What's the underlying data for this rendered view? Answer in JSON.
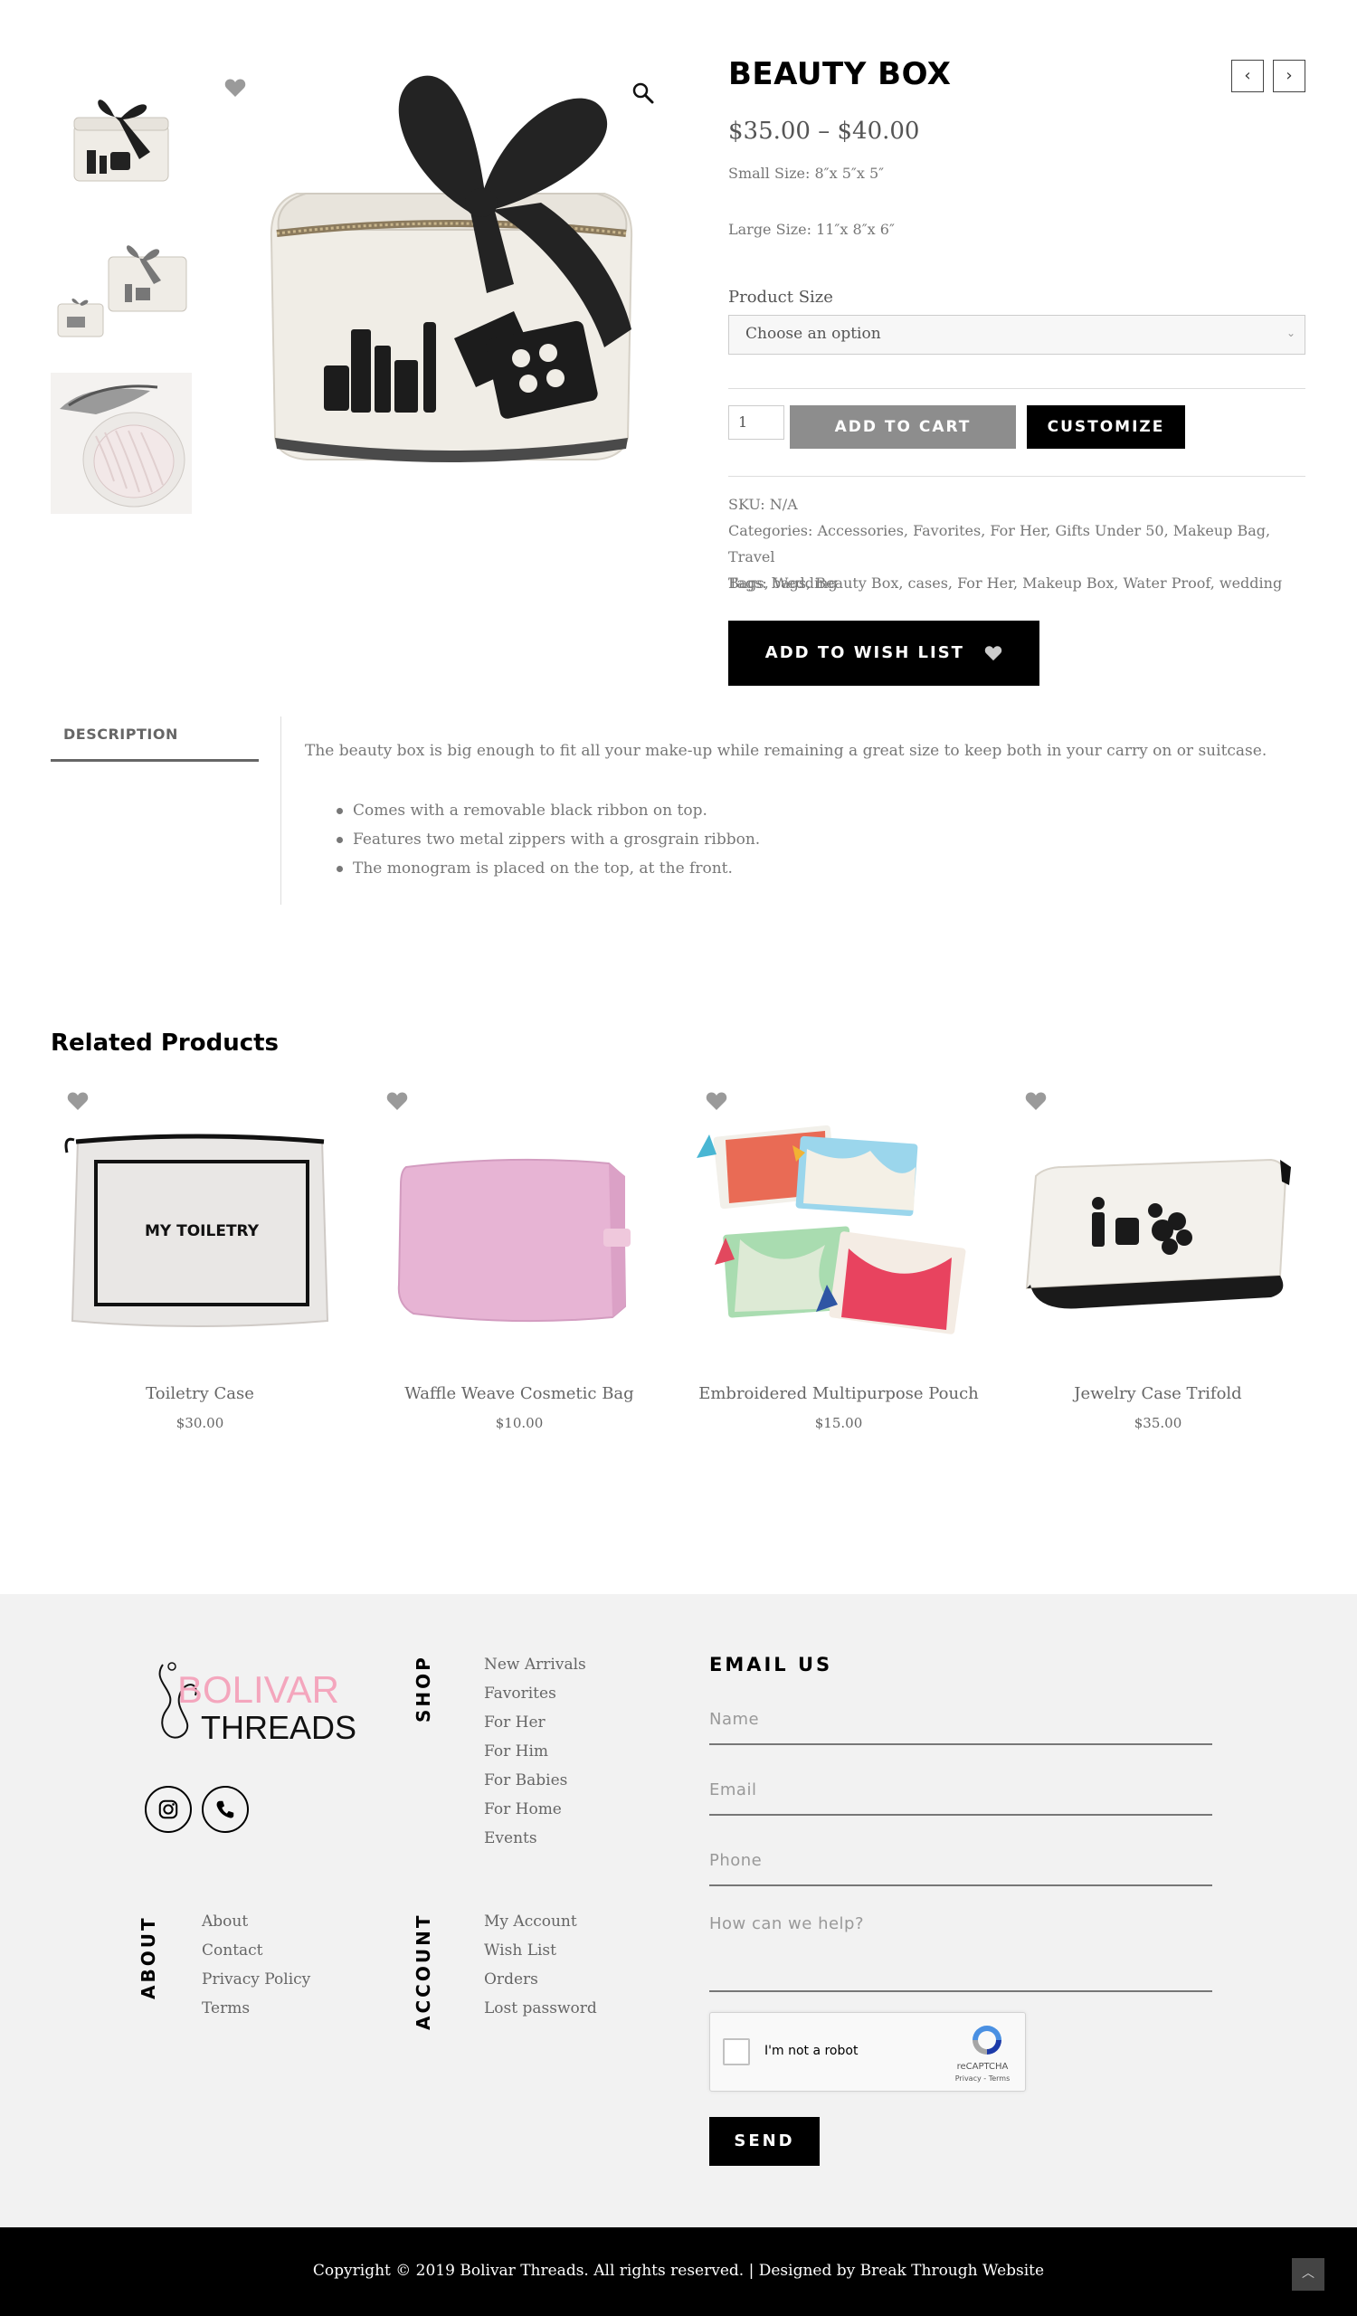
{
  "product": {
    "title": "BEAUTY BOX",
    "price_range": "$35.00 – $40.00",
    "small_size": "Small Size: 8″x 5″x 5″",
    "large_size": "Large Size: 11″x 8″x 6″",
    "size_label": "Product Size",
    "size_select_value": "Choose an option",
    "quantity": "1",
    "add_to_cart": "ADD TO CART",
    "customize": "CUSTOMIZE",
    "sku": "SKU: N/A",
    "categories_line1": "Categories: Accessories, Favorites, For Her, Gifts Under 50, Makeup Bag, Travel",
    "categories_line2": "Bags, Wedding",
    "tags": "Tags: bags, Beauty Box, cases, For Her, Makeup Box, Water Proof, wedding",
    "add_to_wishlist": "ADD TO WISH LIST",
    "prev_icon": "chevron-left-icon",
    "next_icon": "chevron-right-icon"
  },
  "description": {
    "tab_label": "DESCRIPTION",
    "paragraph": "The beauty box is big enough to fit all your make-up while remaining a great size to keep both in your carry on or suitcase.",
    "bullets": [
      "Comes with a removable black ribbon on top.",
      "Features two metal zippers with a grosgrain ribbon.",
      "The monogram is placed on the top, at the front."
    ]
  },
  "related": {
    "title": "Related Products",
    "items": [
      {
        "name": "Toiletry Case",
        "price": "$30.00",
        "print": "MY TOILETRY"
      },
      {
        "name": "Waffle Weave Cosmetic Bag",
        "price": "$10.00"
      },
      {
        "name": "Embroidered Multipurpose Pouch",
        "price": "$15.00"
      },
      {
        "name": "Jewelry Case Trifold",
        "price": "$35.00"
      }
    ]
  },
  "footer": {
    "logo_line1": "BOLIVAR",
    "logo_line2": "THREADS",
    "shop_label": "SHOP",
    "shop_links": [
      "New Arrivals",
      "Favorites",
      "For Her",
      "For Him",
      "For Babies",
      "For Home",
      "Events"
    ],
    "about_label": "ABOUT",
    "about_links": [
      "About",
      "Contact",
      "Privacy Policy",
      "Terms"
    ],
    "account_label": "ACCOUNT",
    "account_links": [
      "My Account",
      "Wish List",
      "Orders",
      "Lost password"
    ],
    "email_title": "EMAIL US",
    "name_placeholder": "Name",
    "email_placeholder": "Email",
    "phone_placeholder": "Phone",
    "message_placeholder": "How can we help?",
    "recaptcha_label": "I'm not a robot",
    "recaptcha_brand": "reCAPTCHA",
    "recaptcha_terms": "Privacy - Terms",
    "send": "SEND",
    "copyright": "Copyright © 2019 Bolivar Threads. All rights reserved. | Designed by Break Through Website",
    "totop_icon": "chevron-up-icon"
  },
  "colors": {
    "brand_pink": "#f4a6bd",
    "black": "#000000",
    "footer_bg": "#f2f2f2",
    "cart_button": "#8d8d8d"
  }
}
